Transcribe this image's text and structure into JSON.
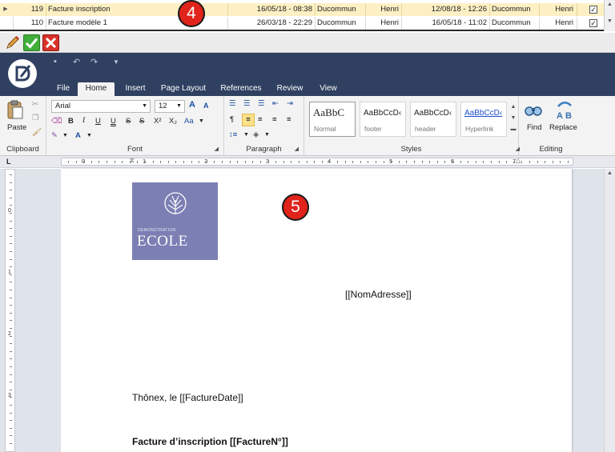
{
  "grid": {
    "rows": [
      {
        "num": "119",
        "name": "Facture inscription",
        "created": "16/05/18 - 08:38",
        "created_user": "Ducommun",
        "created_first": "Henri",
        "modified": "12/08/18 - 12:26",
        "modified_user": "Ducommun",
        "modified_first": "Henri",
        "checked": true,
        "current": true
      },
      {
        "num": "110",
        "name": "Facture modèle 1",
        "created": "26/03/18 - 22:29",
        "created_user": "Ducommun",
        "created_first": "Henri",
        "modified": "16/05/18 - 11:02",
        "modified_user": "Ducommun",
        "modified_first": "Henri",
        "checked": true,
        "current": false
      }
    ],
    "check_mark": "✓"
  },
  "callouts": {
    "grid": "4",
    "editor": "5"
  },
  "edit_toolbar": {
    "icons": [
      "pencil-icon",
      "check-icon",
      "close-icon"
    ]
  },
  "ribbon": {
    "tabs": [
      "File",
      "Home",
      "Insert",
      "Page Layout",
      "References",
      "Review",
      "View"
    ],
    "active_tab": "Home",
    "clipboard": {
      "paste_label": "Paste",
      "group_label": "Clipboard"
    },
    "font": {
      "family": "Arial",
      "size": "12",
      "group_label": "Font",
      "case_label": "Aa"
    },
    "paragraph": {
      "group_label": "Paragraph"
    },
    "styles": {
      "group_label": "Styles",
      "cards": [
        {
          "preview": "AaBbC",
          "name": "Normal"
        },
        {
          "preview": "AaBbCcD‹",
          "name": "footer"
        },
        {
          "preview": "AaBbCcD‹",
          "name": "header"
        },
        {
          "preview": "AaBbCcD‹",
          "name": "Hyperlink"
        }
      ]
    },
    "editing": {
      "find_label": "Find",
      "replace_label": "Replace",
      "group_label": "Editing"
    }
  },
  "ruler": {
    "numbers": [
      "0",
      "1",
      "2",
      "3",
      "4",
      "5",
      "6",
      "7"
    ],
    "vertical_numbers": [
      "0",
      "1",
      "2",
      "3"
    ],
    "corner": "L"
  },
  "document": {
    "logo_small": "DEMONSTRATION",
    "logo_big": "ECOLE",
    "address_field": "[[NomAdresse]]",
    "date_line": "Thônex, le [[FactureDate]]",
    "title_line": "Facture d’inscription  [[FactureN°]]"
  },
  "colors": {
    "ribbon_dark": "#2f4061",
    "row_highlight": "#fdf0c4",
    "logo_bg": "#7c7fb3",
    "callout": "#e0231b"
  }
}
